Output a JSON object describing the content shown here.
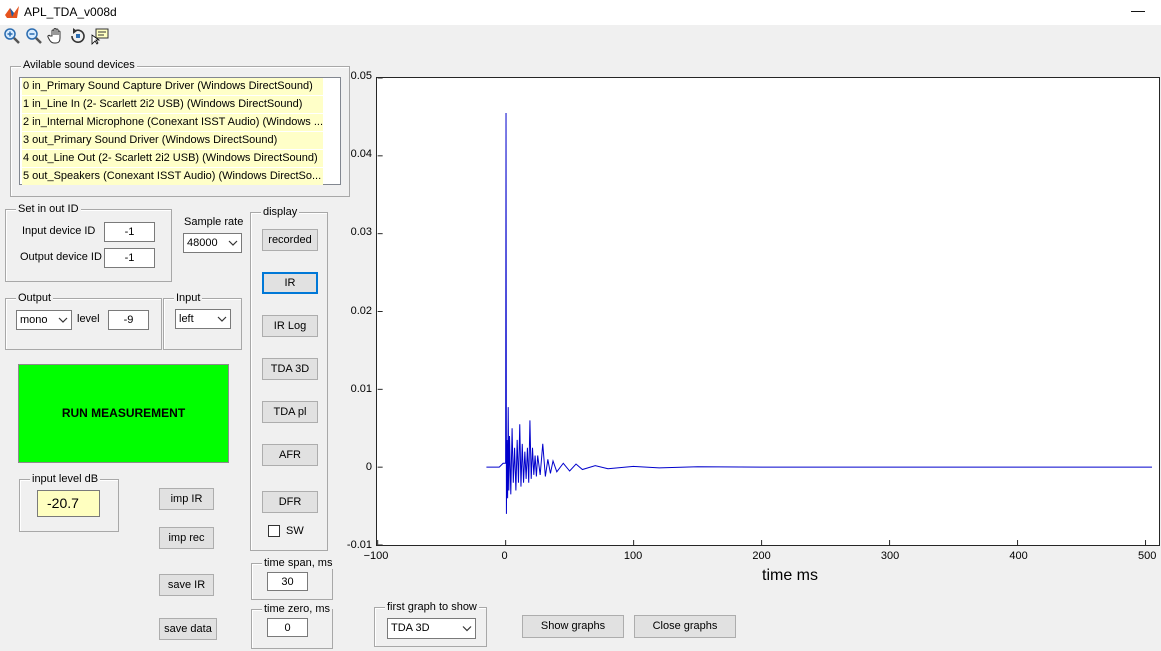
{
  "window": {
    "title": "APL_TDA_v008d",
    "minimize_glyph": "—"
  },
  "toolbar": {
    "tools": [
      "zoom-in-icon",
      "zoom-out-icon",
      "pan-icon",
      "rotate-icon",
      "data-cursor-icon"
    ]
  },
  "devices": {
    "legend": "Avilable sound devices",
    "items": [
      "0 in_Primary Sound Capture Driver (Windows DirectSound)",
      "1 in_Line In (2- Scarlett 2i2 USB) (Windows DirectSound)",
      "2 in_Internal Microphone (Conexant ISST Audio) (Windows ...",
      "3 out_Primary Sound Driver (Windows DirectSound)",
      "4 out_Line Out (2- Scarlett 2i2 USB) (Windows DirectSound)",
      "5 out_Speakers (Conexant ISST Audio) (Windows DirectSo..."
    ]
  },
  "inout": {
    "legend": "Set in out ID",
    "input_label": "Input device ID",
    "input_value": "-1",
    "output_label": "Output device ID",
    "output_value": "-1"
  },
  "sample_rate": {
    "label": "Sample rate",
    "value": "48000"
  },
  "output": {
    "legend": "Output",
    "mode": "mono",
    "level_label": "level",
    "level_value": "-9"
  },
  "input": {
    "legend": "Input",
    "channel": "left"
  },
  "run_label": "RUN MEASUREMENT",
  "input_level": {
    "legend": "input level dB",
    "value": "-20.7"
  },
  "buttons": {
    "imp_ir": "imp IR",
    "imp_rec": "imp rec",
    "save_ir": "save IR",
    "save_data": "save data"
  },
  "display": {
    "legend": "display",
    "buttons": [
      "recorded",
      "IR",
      "IR Log",
      "TDA 3D",
      "TDA pl",
      "AFR",
      "DFR"
    ],
    "sw_label": "SW",
    "sw_checked": false
  },
  "time_span": {
    "legend": "time span, ms",
    "value": "30"
  },
  "time_zero": {
    "legend": "time zero, ms",
    "value": "0"
  },
  "first_graph": {
    "legend": "first graph to show",
    "value": "TDA 3D"
  },
  "show_graphs": "Show graphs",
  "close_graphs": "Close graphs",
  "chart_data": {
    "type": "line",
    "xlabel": "time  ms",
    "xlim": [
      -100,
      510
    ],
    "ylim": [
      -0.01,
      0.05
    ],
    "xticks": [
      -100,
      0,
      100,
      200,
      300,
      400,
      500
    ],
    "yticks": [
      -0.01,
      0,
      0.01,
      0.02,
      0.03,
      0.04,
      0.05
    ],
    "xtick_labels": [
      "−100",
      "0",
      "100",
      "200",
      "300",
      "400",
      "500"
    ],
    "ytick_labels": [
      "-0.01",
      "0",
      "0.01",
      "0.02",
      "0.03",
      "0.04",
      "0.05"
    ],
    "grid": false,
    "color": "#0000cc",
    "series": [
      {
        "x": [
          -15,
          -5,
          -2,
          0,
          0.3,
          0.6,
          1,
          1.5,
          2,
          2.5,
          3,
          4,
          5,
          6,
          7,
          8,
          9,
          10,
          11,
          12,
          13,
          14,
          15,
          16,
          17,
          18,
          19,
          20,
          21,
          22,
          23,
          24,
          25,
          27,
          29,
          31,
          33,
          35,
          37,
          40,
          45,
          50,
          55,
          60,
          70,
          80,
          100,
          120,
          150,
          200,
          250,
          300,
          400,
          505
        ],
        "y": [
          0,
          0,
          0.0005,
          0.0005,
          0.0455,
          -0.006,
          0.0035,
          -0.004,
          0.0077,
          -0.003,
          0.004,
          -0.0035,
          0.005,
          -0.002,
          0.0025,
          -0.003,
          0.0035,
          -0.002,
          0.0055,
          -0.0025,
          0.003,
          -0.002,
          0.002,
          -0.0015,
          0.0025,
          -0.002,
          0.006,
          -0.0015,
          0.0025,
          -0.001,
          0.0015,
          -0.0012,
          0.0015,
          -0.001,
          0.003,
          -0.0012,
          0.001,
          -0.0008,
          0.0008,
          -0.0006,
          0.0005,
          -0.0005,
          0.0004,
          -0.0003,
          0.0002,
          -0.0002,
          0.0001,
          -0.0001,
          5e-05,
          0,
          0,
          0,
          0,
          0
        ]
      }
    ]
  }
}
